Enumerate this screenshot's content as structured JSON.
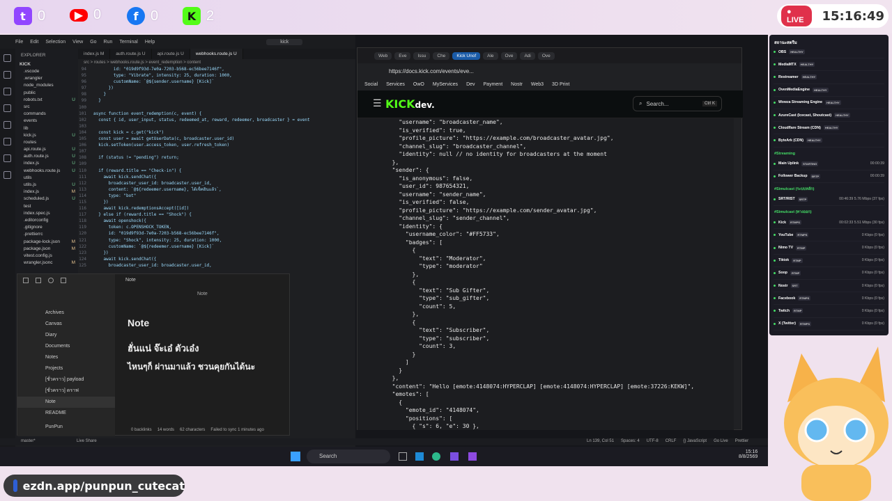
{
  "overlay": {
    "socials": [
      {
        "name": "Twitch",
        "count": "0",
        "color": "#9146ff"
      },
      {
        "name": "YouTube",
        "count": "0",
        "color": "#ff0000"
      },
      {
        "name": "Facebook",
        "count": "0",
        "color": "#1877f2"
      },
      {
        "name": "Kick",
        "count": "2",
        "color": "#53fc18"
      }
    ],
    "live_label": "LIVE",
    "clock": "15:16:49",
    "link_text": "ezdn.app/punpun_cutecat"
  },
  "vscode": {
    "menu": [
      "File",
      "Edit",
      "Selection",
      "View",
      "Go",
      "Run",
      "Terminal",
      "Help"
    ],
    "search": "kick",
    "explorer_title": "EXPLORER",
    "root": "KICK",
    "tree": [
      {
        "n": ".vscode",
        "s": ""
      },
      {
        "n": ".wrangler",
        "s": ""
      },
      {
        "n": "node_modules",
        "s": ""
      },
      {
        "n": "public",
        "s": ""
      },
      {
        "n": "robots.txt",
        "s": "U"
      },
      {
        "n": "src",
        "s": ""
      },
      {
        "n": "commands",
        "s": ""
      },
      {
        "n": "events",
        "s": ""
      },
      {
        "n": "lib",
        "s": ""
      },
      {
        "n": "kick.js",
        "s": "U"
      },
      {
        "n": "routes",
        "s": ""
      },
      {
        "n": "api.route.js",
        "s": "U"
      },
      {
        "n": "auth.route.js",
        "s": "U"
      },
      {
        "n": "index.js",
        "s": "U"
      },
      {
        "n": "webhooks.route.js",
        "s": "U"
      },
      {
        "n": "utils",
        "s": ""
      },
      {
        "n": "utils.js",
        "s": "U"
      },
      {
        "n": "index.js",
        "s": "M"
      },
      {
        "n": "scheduled.js",
        "s": "U"
      },
      {
        "n": "test",
        "s": ""
      },
      {
        "n": "index.spec.js",
        "s": ""
      },
      {
        "n": ".editorconfig",
        "s": ""
      },
      {
        "n": ".gitignore",
        "s": ""
      },
      {
        "n": ".prettierrc",
        "s": ""
      },
      {
        "n": "package-lock.json",
        "s": "M"
      },
      {
        "n": "package.json",
        "s": "M"
      },
      {
        "n": "vitest.config.js",
        "s": ""
      },
      {
        "n": "wrangler.jsonc",
        "s": "M"
      }
    ],
    "tabs": [
      {
        "label": "index.js M",
        "active": false
      },
      {
        "label": "auth.route.js U",
        "active": false
      },
      {
        "label": "api.route.js U",
        "active": false
      },
      {
        "label": "webhooks.route.js U",
        "active": true
      }
    ],
    "breadcrumb": "src > routes > webhooks.route.js > event_redemption > content",
    "code": [
      {
        "n": "94",
        "t": "        id: \"019d9f93d-7e0a-7203-b568-ec56bee7146f\","
      },
      {
        "n": "95",
        "t": "        type: \"Vibrate\", intensity: 25, duration: 1000,"
      },
      {
        "n": "96",
        "t": "        customName: `@${sender.username} [Kick]`"
      },
      {
        "n": "97",
        "t": "      })"
      },
      {
        "n": "98",
        "t": "    }"
      },
      {
        "n": "99",
        "t": "  }"
      },
      {
        "n": "100",
        "t": ""
      },
      {
        "n": "101",
        "t": "async function event_redemption(c, event) {"
      },
      {
        "n": "102",
        "t": "  const { id, user_input, status, redeemed_at, reward, redeemer, broadcaster } = event"
      },
      {
        "n": "103",
        "t": ""
      },
      {
        "n": "104",
        "t": "  const kick = c.get(\"kick\")"
      },
      {
        "n": "105",
        "t": "  const user = await getUserData(c, broadcaster.user_id)"
      },
      {
        "n": "106",
        "t": "  kick.setToken(user.access_token, user.refresh_token)"
      },
      {
        "n": "107",
        "t": ""
      },
      {
        "n": "108",
        "t": "  if (status != \"pending\") return;"
      },
      {
        "n": "109",
        "t": ""
      },
      {
        "n": "110",
        "t": "  if (reward.title == \"Check-in\") {"
      },
      {
        "n": "111",
        "t": "    await kick.sendChat({"
      },
      {
        "n": "112",
        "t": "      broadcaster_user_id: broadcaster.user_id,"
      },
      {
        "n": "113",
        "t": "      content: `@${redeemer.username}, ได้เช็คอินแล้ว`,"
      },
      {
        "n": "114",
        "t": "      type: \"bot\""
      },
      {
        "n": "115",
        "t": "    })"
      },
      {
        "n": "116",
        "t": "    await kick.redemptionsAccept([id])"
      },
      {
        "n": "117",
        "t": "  } else if (reward.title == \"Shock\") {"
      },
      {
        "n": "118",
        "t": "    await openshock({"
      },
      {
        "n": "119",
        "t": "      token: c.OPENSHOCK_TOKEN,"
      },
      {
        "n": "120",
        "t": "      id: \"019d9f93d-7e0a-7203-b568-ec56bee7146f\","
      },
      {
        "n": "121",
        "t": "      type: \"Shock\", intensity: 25, duration: 1000,"
      },
      {
        "n": "122",
        "t": "      customName: `@${redeemer.username} [Kick]`"
      },
      {
        "n": "123",
        "t": "    })"
      },
      {
        "n": "124",
        "t": "    await kick.sendChat({"
      },
      {
        "n": "125",
        "t": "      broadcaster_user_id: broadcaster.user_id,"
      }
    ],
    "status_left": "master*",
    "status_live": "Live Share",
    "status_right": [
      "Ln 139, Col 51",
      "Spaces: 4",
      "UTF-8",
      "CRLF",
      "{} JavaScript",
      "Go Live",
      "Prettier"
    ]
  },
  "notes": {
    "window_title": "Note",
    "tab_title": "Note",
    "tree": [
      {
        "n": "Archives",
        "sel": false
      },
      {
        "n": "Canvas",
        "sel": false
      },
      {
        "n": "Diary",
        "sel": false
      },
      {
        "n": "Documents",
        "sel": false
      },
      {
        "n": "Notes",
        "sel": false
      },
      {
        "n": "Projects",
        "sel": false
      },
      {
        "n": "[ชั่วคราว] payload",
        "sel": false
      },
      {
        "n": "[ชั่วคราว] ดราฟ",
        "sel": false
      },
      {
        "n": "Note",
        "sel": true
      },
      {
        "n": "README",
        "sel": false
      }
    ],
    "vault": "PunPun",
    "heading": "Note",
    "line1": "ฮั่นแน่ จ๊ะเอ๋ ตัวเอ๋ง",
    "line2": "ไหนๆก็ ผ่านมาแล้ว ชวนคุยกันได้นะ",
    "footer": [
      "0 backlinks",
      "14 words",
      "62 characters",
      "Failed to sync 1 minutes ago"
    ]
  },
  "browser": {
    "tabs": [
      {
        "label": "Web",
        "hl": false
      },
      {
        "label": "Eve",
        "hl": false
      },
      {
        "label": "Issu",
        "hl": false
      },
      {
        "label": "Che",
        "hl": false
      },
      {
        "label": "Kick Unof",
        "hl": true
      },
      {
        "label": "Ale",
        "hl": false
      },
      {
        "label": "Ove",
        "hl": false
      },
      {
        "label": "Adi",
        "hl": false
      },
      {
        "label": "Ove",
        "hl": false
      }
    ],
    "url": "https://docs.kick.com/events/eve...",
    "bookmarks": [
      "Social",
      "Services",
      "OwO",
      "MyServices",
      "Dev",
      "Payment",
      "Nostr",
      "Web3",
      "3D Print"
    ],
    "kick_logo": "KICK",
    "kick_dev": "dev.",
    "search_placeholder": "Search...",
    "search_kbd": "Ctrl K",
    "json_lines": [
      "    \"username\": \"broadcaster_name\",",
      "    \"is_verified\": true,",
      "    \"profile_picture\": \"https://example.com/broadcaster_avatar.jpg\",",
      "    \"channel_slug\": \"broadcaster_channel\",",
      "    \"identity\": null // no identity for broadcasters at the moment",
      "  },",
      "  \"sender\": {",
      "    \"is_anonymous\": false,",
      "    \"user_id\": 987654321,",
      "    \"username\": \"sender_name\",",
      "    \"is_verified\": false,",
      "    \"profile_picture\": \"https://example.com/sender_avatar.jpg\",",
      "    \"channel_slug\": \"sender_channel\",",
      "    \"identity\": {",
      "      \"username_color\": \"#FF5733\",",
      "      \"badges\": [",
      "        {",
      "          \"text\": \"Moderator\",",
      "          \"type\": \"moderator\"",
      "        },",
      "        {",
      "          \"text\": \"Sub Gifter\",",
      "          \"type\": \"sub_gifter\",",
      "          \"count\": 5,",
      "        },",
      "        {",
      "          \"text\": \"Subscriber\",",
      "          \"type\": \"subscriber\",",
      "          \"count\": 3,",
      "        }",
      "      ]",
      "    }",
      "  },",
      "  \"content\": \"Hello [emote:4148074:HYPERCLAP] [emote:4148074:HYPERCLAP] [emote:37226:KEKW]\",",
      "  \"emotes\": [",
      "    {",
      "      \"emote_id\": \"4148074\",",
      "      \"positions\": [",
      "        { \"s\": 6, \"e\": 30 },"
    ]
  },
  "taskbar": {
    "search": "Search",
    "time": "15:16",
    "date": "8/8/2569"
  },
  "obs": {
    "title": "สถานะสตรีม",
    "services": [
      {
        "name": "OBS",
        "tag": "HEALTHY"
      },
      {
        "name": "MediaMTX",
        "tag": "HEALTHY"
      },
      {
        "name": "Restreamer",
        "tag": "HEALTHY"
      },
      {
        "name": "OvenMediaEngine",
        "tag": "HEALTHY"
      },
      {
        "name": "Wowza Streaming Engine",
        "tag": "HEALTHY"
      },
      {
        "name": "AzureCast (Icecast, Shoutcast)",
        "tag": "HEALTHY"
      },
      {
        "name": "Cloudflare Stream (CDN)",
        "tag": "HEALTHY"
      },
      {
        "name": "ByteArk (CDN)",
        "tag": "HEALTHY"
      }
    ],
    "streaming_label": "#Streaming",
    "streaming": [
      {
        "name": "Main Uplink",
        "tag": "STARTING",
        "val": "00:00:39"
      },
      {
        "name": "Follower Backup",
        "tag": "SRTP",
        "val": "00:00:39"
      }
    ],
    "simulcast1_label": "#Simulcast (ระบบหลัก)",
    "simulcast1": [
      {
        "name": "SRT/RIST",
        "tag": "SRTP",
        "val": "00:46:39  5.76 Mbps  (37 fps)"
      }
    ],
    "simulcast2_label": "#Simulcast (ทางออก)",
    "simulcast2": [
      {
        "name": "Kick",
        "tag": "RTMPS",
        "val": "00:02:33  5.51 Mbps  (30 fps)"
      },
      {
        "name": "YouTube",
        "tag": "RTMPS",
        "val": "0 Kbps  (0 fps)"
      },
      {
        "name": "Nimo TV",
        "tag": "RTMP",
        "val": "0 Kbps  (0 fps)"
      },
      {
        "name": "Tiktok",
        "tag": "RTMP",
        "val": "0 Kbps  (0 fps)"
      },
      {
        "name": "Soop",
        "tag": "RTMP",
        "val": "0 Kbps  (0 fps)"
      },
      {
        "name": "Nostr",
        "tag": "SRT",
        "val": "0 Kbps  (0 fps)"
      },
      {
        "name": "Facebook",
        "tag": "RTMPS",
        "val": "0 Kbps  (0 fps)"
      },
      {
        "name": "Twitch",
        "tag": "RTMP",
        "val": "0 Kbps  (0 fps)"
      },
      {
        "name": "X (Twitter)",
        "tag": "RTMPS",
        "val": "0 Kbps  (0 fps)"
      }
    ]
  }
}
